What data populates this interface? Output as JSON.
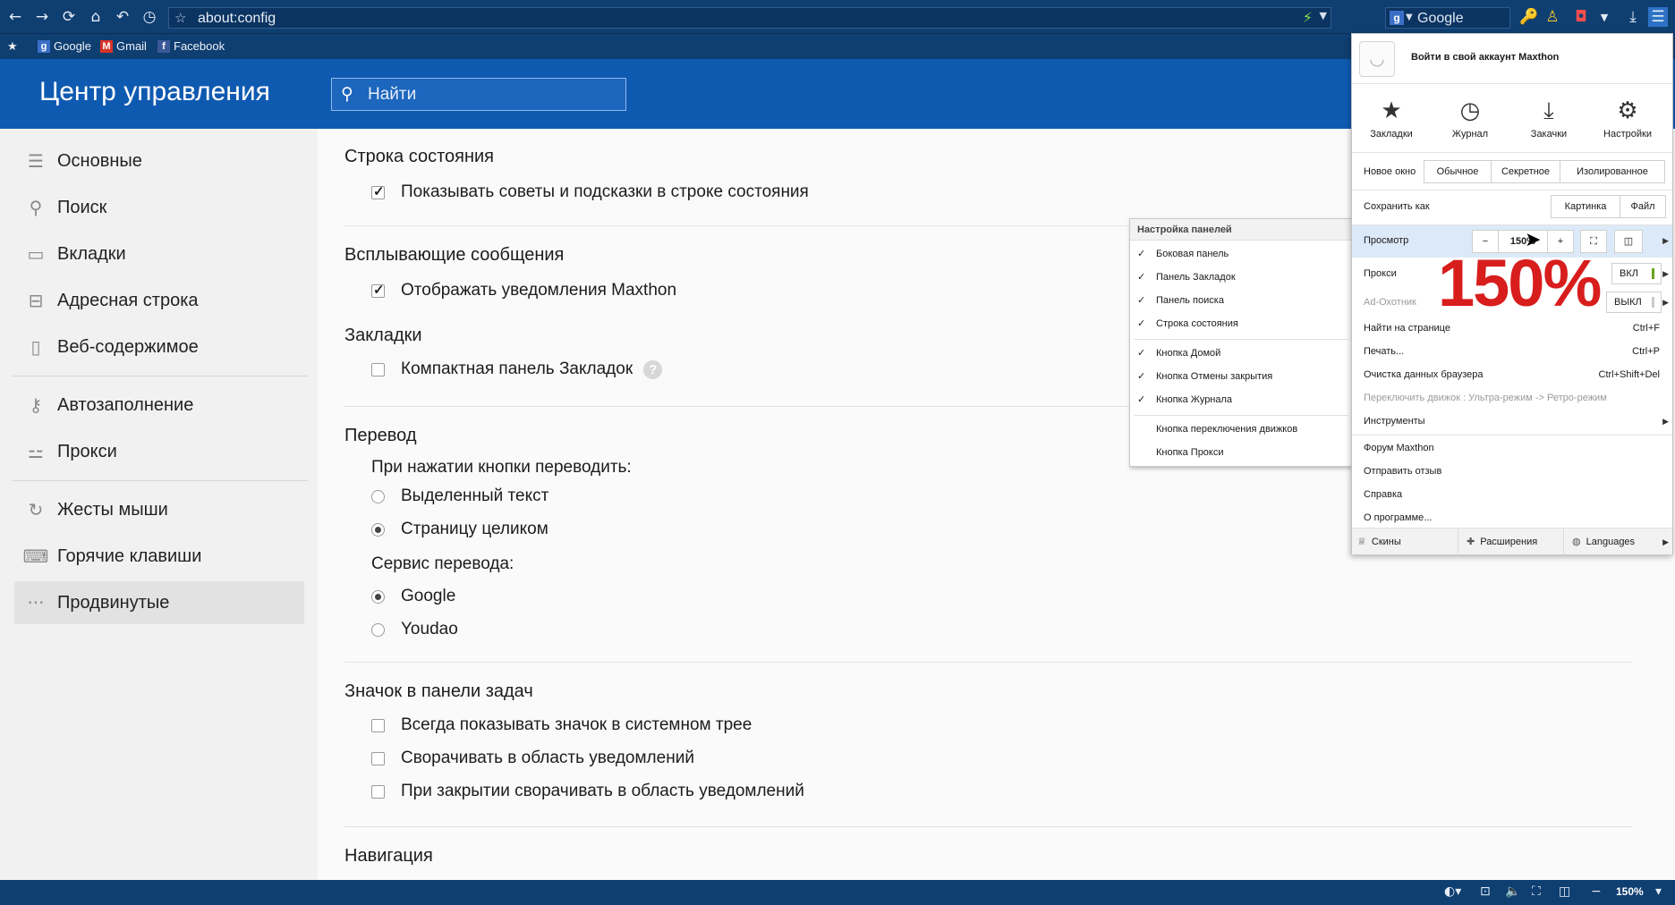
{
  "browser": {
    "address": "about:config",
    "search_engine": "Google",
    "bookmarks": [
      {
        "label": "Google",
        "icon": "google-icon"
      },
      {
        "label": "Gmail",
        "icon": "gmail-icon"
      },
      {
        "label": "Facebook",
        "icon": "facebook-icon"
      }
    ]
  },
  "header": {
    "title": "Центр управления",
    "search_placeholder": "Найти"
  },
  "sidebar": {
    "items": [
      {
        "label": "Основные",
        "icon": "sliders-icon"
      },
      {
        "label": "Поиск",
        "icon": "search-icon"
      },
      {
        "label": "Вкладки",
        "icon": "tabs-icon"
      },
      {
        "label": "Адресная строка",
        "icon": "address-bar-icon"
      },
      {
        "label": "Веб-содержимое",
        "icon": "page-icon"
      },
      {
        "label": "Автозаполнение",
        "icon": "key-icon"
      },
      {
        "label": "Прокси",
        "icon": "proxy-icon"
      },
      {
        "label": "Жесты мыши",
        "icon": "mouse-gesture-icon"
      },
      {
        "label": "Горячие клавиши",
        "icon": "hotkeys-icon"
      },
      {
        "label": "Продвинутые",
        "icon": "more-icon"
      }
    ],
    "active": "Продвинутые"
  },
  "main": {
    "status_bar_section": {
      "title": "Строка состояния",
      "option": "Показывать советы и подсказки в строке состояния",
      "checked": true
    },
    "popup_section": {
      "title": "Всплывающие сообщения",
      "option": "Отображать уведомления Maxthon",
      "checked": true
    },
    "bookmarks_section": {
      "title": "Закладки",
      "option": "Компактная панель Закладок",
      "checked": false,
      "help": "?"
    },
    "translate_section": {
      "title": "Перевод",
      "label1": "При нажатии кнопки переводить:",
      "opt_selected": "Выделенный текст",
      "opt_page": "Страницу целиком",
      "label2": "Сервис перевода:",
      "opt_google": "Google",
      "opt_youdao": "Youdao"
    },
    "tray_section": {
      "title": "Значок в панели задач",
      "opt1": "Всегда показывать значок в системном трее",
      "opt2": "Сворачивать в область уведомлений",
      "opt3": "При закрытии сворачивать в область уведомлений"
    },
    "nav_section": {
      "title": "Навигация"
    }
  },
  "panel_menu": {
    "title": "Настройка панелей",
    "items": [
      {
        "label": "Боковая панель",
        "checked": true
      },
      {
        "label": "Панель Закладок",
        "checked": true
      },
      {
        "label": "Панель поиска",
        "checked": true
      },
      {
        "label": "Строка состояния",
        "checked": true
      },
      {
        "label": "Кнопка Домой",
        "checked": true
      },
      {
        "label": "Кнопка Отмены закрытия",
        "checked": true
      },
      {
        "label": "Кнопка Журнала",
        "checked": true
      },
      {
        "label": "Кнопка переключения движков",
        "checked": false
      },
      {
        "label": "Кнопка Прокси",
        "checked": false
      }
    ],
    "check_mark": "✓"
  },
  "main_menu": {
    "account": "Войти в свой аккаунт Maxthon",
    "quick": [
      {
        "label": "Закладки",
        "icon": "star-icon"
      },
      {
        "label": "Журнал",
        "icon": "clock-icon"
      },
      {
        "label": "Закачки",
        "icon": "download-icon"
      },
      {
        "label": "Настройки",
        "icon": "gear-icon"
      }
    ],
    "new_window": {
      "label": "Новое окно",
      "options": [
        "Обычное",
        "Секретное",
        "Изолированное"
      ]
    },
    "save_as": {
      "label": "Сохранить как",
      "options": [
        "Картинка",
        "Файл"
      ]
    },
    "view": {
      "label": "Просмотр",
      "minus": "−",
      "zoom": "150%",
      "plus": "+"
    },
    "proxy": {
      "label": "Прокси",
      "state": "ВКЛ",
      "state_color": "#6aa21f"
    },
    "adhunter": {
      "label": "Ad-Охотник",
      "state": "ВЫКЛ",
      "state_color": "#c9c9c9"
    },
    "big_zoom": "150%",
    "find": {
      "label": "Найти на странице",
      "shortcut": "Ctrl+F"
    },
    "print": {
      "label": "Печать...",
      "shortcut": "Ctrl+P"
    },
    "clear": {
      "label": "Очистка данных браузера",
      "shortcut": "Ctrl+Shift+Del"
    },
    "engine": "Переключить движок : Ультра-режим -> Ретро-режим",
    "tools": "Инструменты",
    "forum": "Форум Maxthon",
    "feedback": "Отправить отзыв",
    "help": "Справка",
    "about": "О программе...",
    "bottom": [
      {
        "label": "Скины",
        "icon": "shirt-icon"
      },
      {
        "label": "Расширения",
        "icon": "puzzle-icon"
      },
      {
        "label": "Languages",
        "icon": "globe-icon"
      }
    ]
  },
  "status": {
    "zoom": "150%",
    "minus": "−"
  },
  "colors": {
    "chrome": "#0f3e71",
    "header": "#0f5ab1",
    "accent_red": "#d81d1d"
  }
}
